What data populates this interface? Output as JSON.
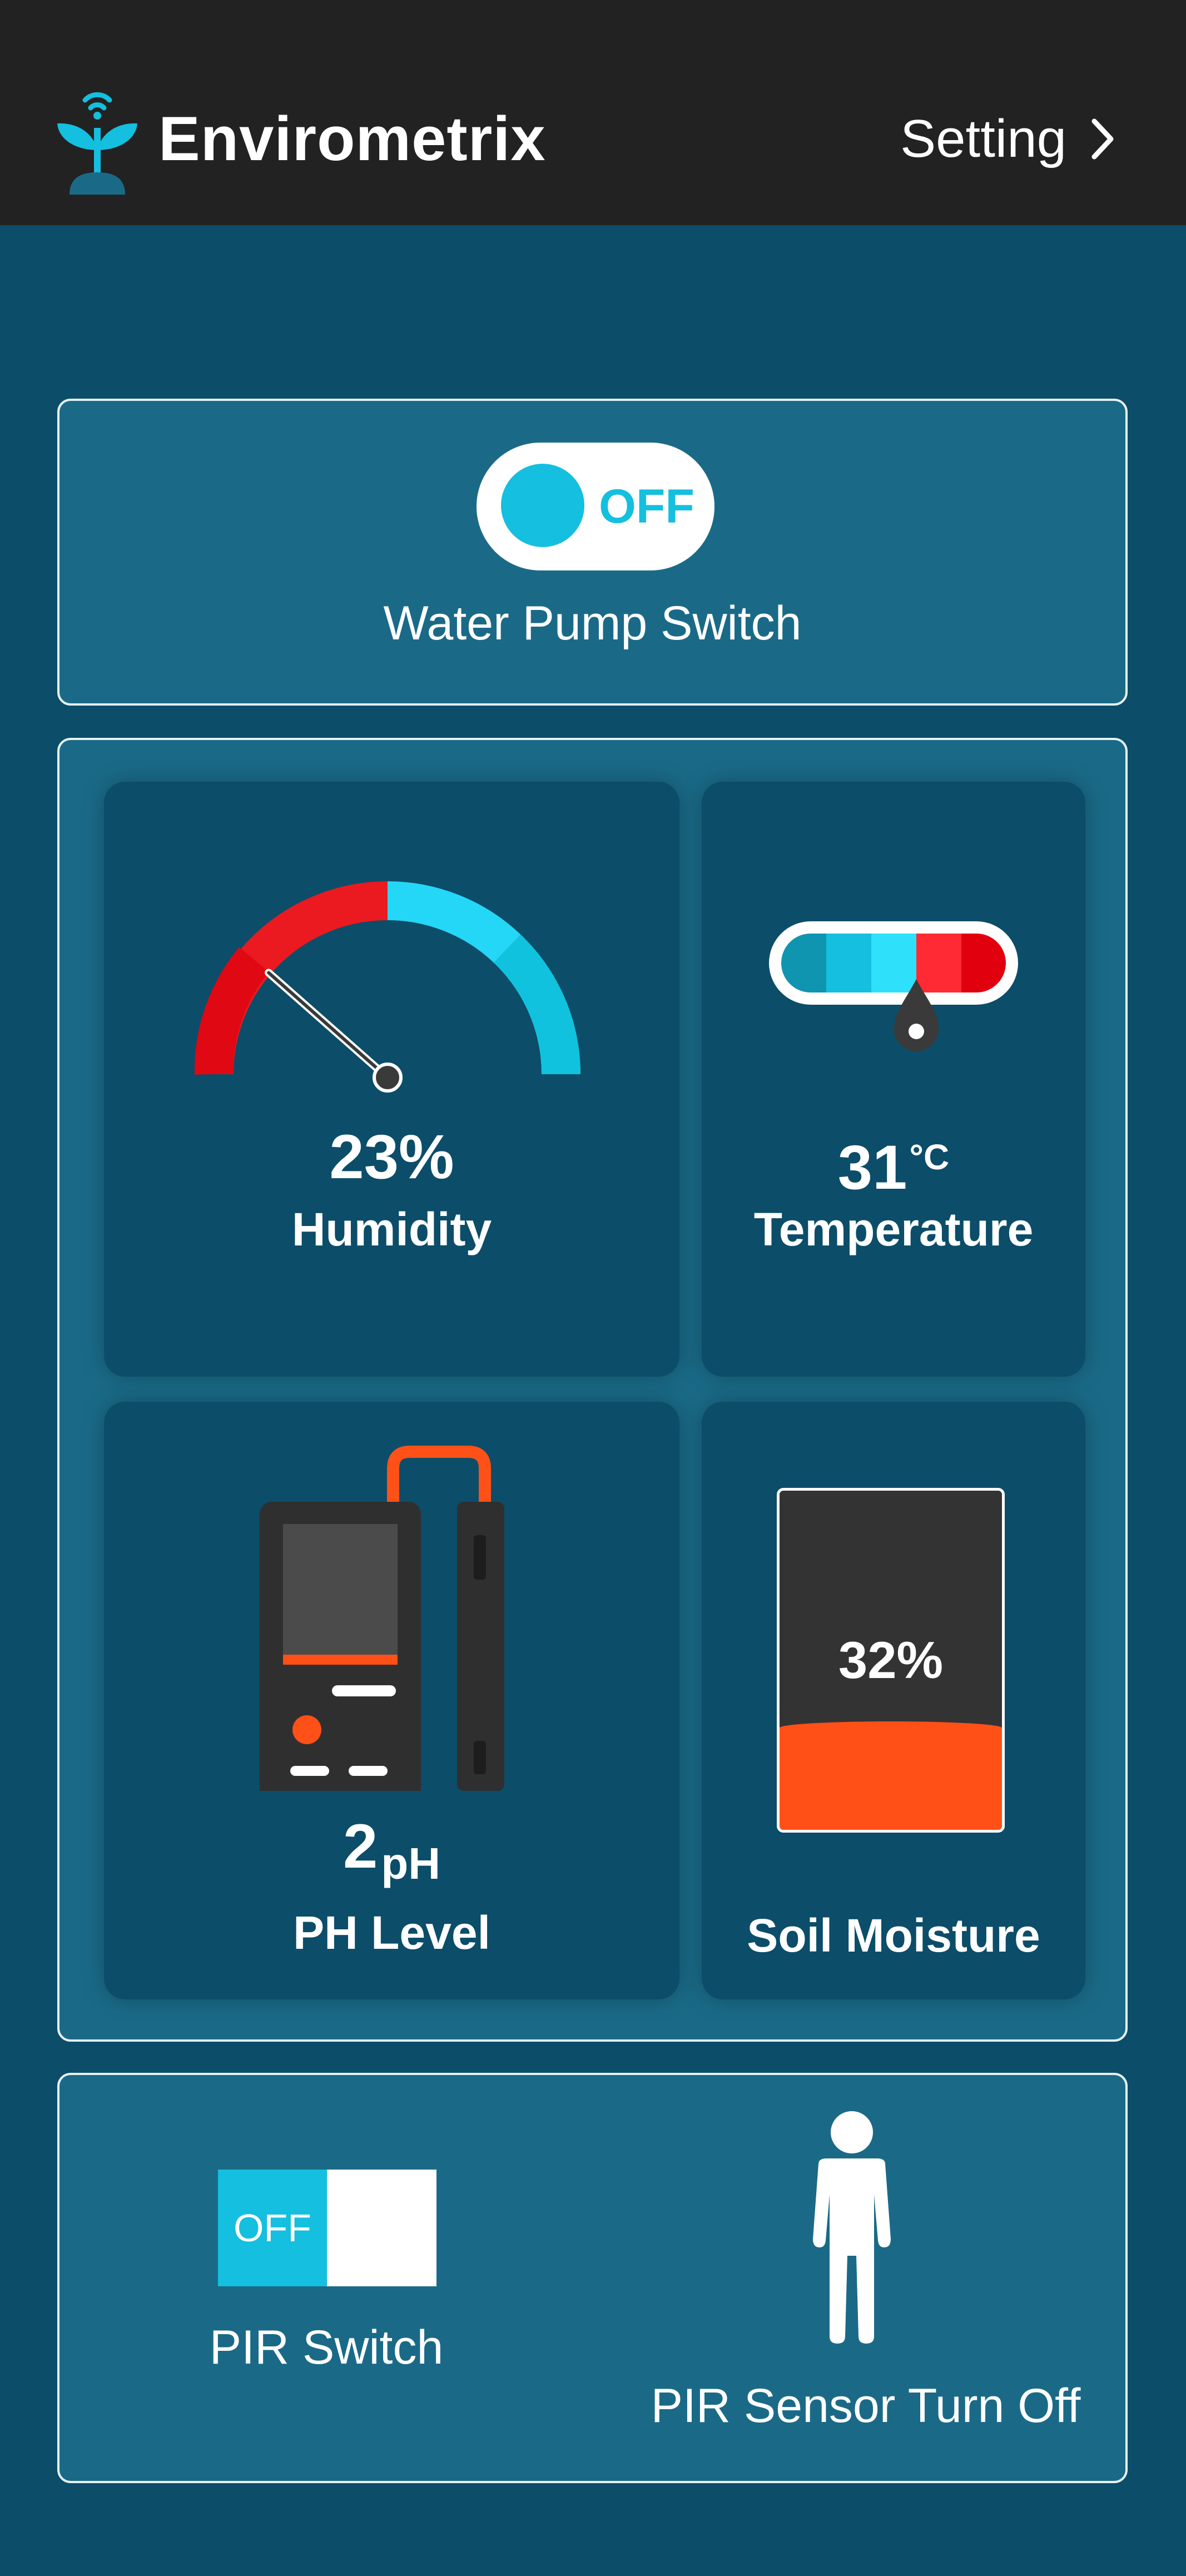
{
  "header": {
    "app_title": "Envirometrix",
    "settings_label": "Setting",
    "logo_icon": "plant-wifi-icon",
    "settings_icon": "chevron-right-icon"
  },
  "water_pump": {
    "toggle_text": "OFF",
    "state": "off",
    "label": "Water Pump Switch"
  },
  "humidity": {
    "value": "23%",
    "label": "Humidity",
    "gauge_fraction": 0.23
  },
  "temperature": {
    "value": "31",
    "unit": "°C",
    "label": "Temperature"
  },
  "ph": {
    "value": "2",
    "unit": "pH",
    "label": "PH Level"
  },
  "soil_moisture": {
    "value": "32%",
    "label": "Soil Moisture",
    "fill_fraction": 0.32
  },
  "pir": {
    "toggle_text": "OFF",
    "state": "off",
    "switch_label": "PIR Switch",
    "status_text": "PIR Sensor Turn Off",
    "status_icon": "person-icon"
  },
  "colors": {
    "background": "#0c4d69",
    "header": "#222222",
    "card": "#1a6a87",
    "accent_cyan": "#14bfdf",
    "alert_red": "#e8141e",
    "soil_orange": "#ff5018"
  }
}
